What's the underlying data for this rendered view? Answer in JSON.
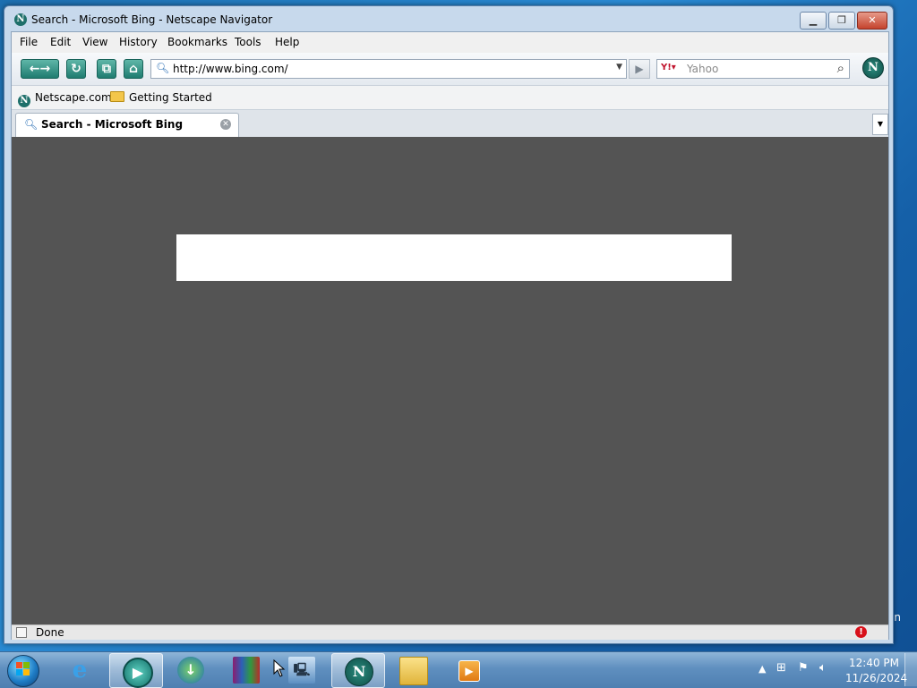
{
  "window": {
    "title": "Search - Microsoft Bing - Netscape Navigator",
    "title_icon_letter": "N"
  },
  "menu": [
    "File",
    "Edit",
    "View",
    "History",
    "Bookmarks",
    "Tools",
    "Help"
  ],
  "toolbar": {
    "back_forward_icon": "back-forward-arrows",
    "reload_icon": "reload",
    "new_tab_icon": "new-window",
    "home_icon": "home",
    "url": "http://www.bing.com/",
    "search_engine": "Yahoo",
    "search_placeholder": "Yahoo",
    "throbber_letter": "N"
  },
  "bookmarks": {
    "items": [
      "Netscape.com",
      "Getting Started"
    ]
  },
  "tabs": [
    {
      "label": "Search - Microsoft Bing",
      "active": true
    }
  ],
  "status": {
    "text": "Done"
  },
  "taskbar": {
    "time": "12:40 PM",
    "date": "11/26/2024",
    "apps": [
      "internet-explorer",
      "app-teal-circle",
      "download-manager",
      "winrar",
      "network-computer",
      "netscape",
      "file-explorer",
      "media-player"
    ]
  },
  "desktop": {
    "edge_text": "n"
  },
  "colors": {
    "content_background": "#545454",
    "accent": "#1f7c70"
  }
}
